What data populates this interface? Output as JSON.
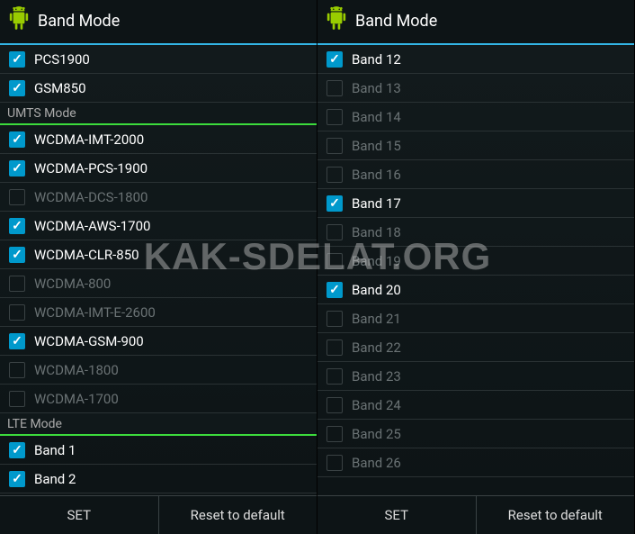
{
  "watermark": "KAK-SDELAT.ORG",
  "panels": [
    {
      "title": "Band Mode",
      "footer": {
        "set": "SET",
        "reset": "Reset to default"
      },
      "sections": [
        {
          "header": null,
          "items": [
            {
              "label": "PCS1900",
              "checked": true
            },
            {
              "label": "GSM850",
              "checked": true
            }
          ]
        },
        {
          "header": "UMTS Mode",
          "items": [
            {
              "label": "WCDMA-IMT-2000",
              "checked": true
            },
            {
              "label": "WCDMA-PCS-1900",
              "checked": true
            },
            {
              "label": "WCDMA-DCS-1800",
              "checked": false
            },
            {
              "label": "WCDMA-AWS-1700",
              "checked": true
            },
            {
              "label": "WCDMA-CLR-850",
              "checked": true
            },
            {
              "label": "WCDMA-800",
              "checked": false
            },
            {
              "label": "WCDMA-IMT-E-2600",
              "checked": false
            },
            {
              "label": "WCDMA-GSM-900",
              "checked": true
            },
            {
              "label": "WCDMA-1800",
              "checked": false
            },
            {
              "label": "WCDMA-1700",
              "checked": false
            }
          ]
        },
        {
          "header": "LTE Mode",
          "items": [
            {
              "label": "Band 1",
              "checked": true
            },
            {
              "label": "Band 2",
              "checked": true
            }
          ]
        }
      ]
    },
    {
      "title": "Band Mode",
      "footer": {
        "set": "SET",
        "reset": "Reset to default"
      },
      "sections": [
        {
          "header": null,
          "items": [
            {
              "label": "Band 12",
              "checked": true
            },
            {
              "label": "Band 13",
              "checked": false
            },
            {
              "label": "Band 14",
              "checked": false
            },
            {
              "label": "Band 15",
              "checked": false
            },
            {
              "label": "Band 16",
              "checked": false
            },
            {
              "label": "Band 17",
              "checked": true
            },
            {
              "label": "Band 18",
              "checked": false
            },
            {
              "label": "Band 19",
              "checked": false
            },
            {
              "label": "Band 20",
              "checked": true
            },
            {
              "label": "Band 21",
              "checked": false
            },
            {
              "label": "Band 22",
              "checked": false
            },
            {
              "label": "Band 23",
              "checked": false
            },
            {
              "label": "Band 24",
              "checked": false
            },
            {
              "label": "Band 25",
              "checked": false
            },
            {
              "label": "Band 26",
              "checked": false
            }
          ]
        }
      ]
    }
  ]
}
